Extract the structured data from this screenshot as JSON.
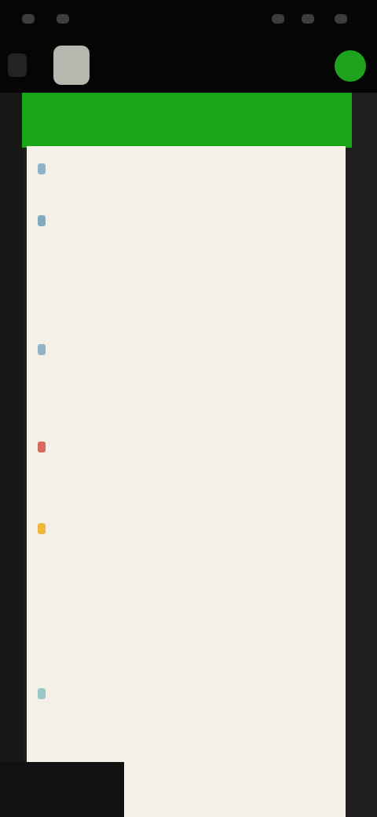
{
  "status_bar": {
    "colors": {
      "background": "#060606",
      "dots": "#3d3d3d"
    }
  },
  "header": {
    "title": "",
    "subtitle": "",
    "icons": {
      "back": "back-icon",
      "avatar": "avatar",
      "action": "more-icon"
    },
    "colors": {
      "background": "#050505",
      "accent": "#1ea31e"
    }
  },
  "banner": {
    "label": "",
    "color": "#18a618"
  },
  "feed": {
    "items": [
      {
        "title": "",
        "lines": [
          ""
        ],
        "link": "",
        "marker_color": "#8fb3c8"
      },
      {
        "title": "",
        "lines": [
          "",
          "",
          ""
        ],
        "link": "",
        "marker_color": "#7ea9bf"
      },
      {
        "title": "",
        "lines": [
          "",
          "",
          ""
        ],
        "link": "",
        "marker_color": "#8fb3c8"
      },
      {
        "title": "",
        "lines": [
          "",
          ""
        ],
        "link": "",
        "marker_color": "#d66a5e"
      },
      {
        "title": "",
        "lines": [
          "",
          "",
          "",
          "",
          "",
          ""
        ],
        "link": "",
        "marker_color": "#f0b83b"
      },
      {
        "title": "",
        "lines": [
          "",
          "",
          "",
          ""
        ],
        "link": "",
        "marker_color": "#9cc7c9"
      }
    ]
  }
}
